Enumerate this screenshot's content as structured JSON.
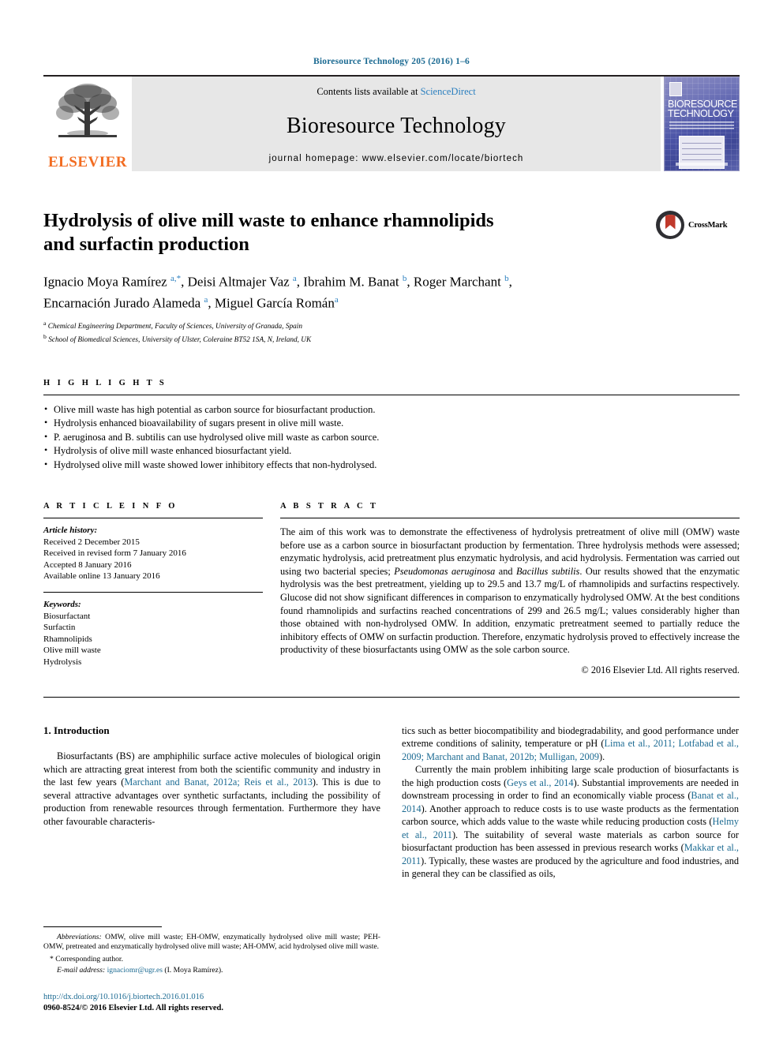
{
  "running_head": "Bioresource Technology 205 (2016) 1–6",
  "masthead": {
    "publisher": "ELSEVIER",
    "contents_prefix": "Contents lists available at ",
    "contents_link": "ScienceDirect",
    "journal_name": "Bioresource Technology",
    "homepage": "journal homepage: www.elsevier.com/locate/biortech",
    "cover_title_line1": "BIORESOURCE",
    "cover_title_line2": "TECHNOLOGY"
  },
  "article": {
    "title_line1": "Hydrolysis of olive mill waste to enhance rhamnolipids",
    "title_line2": "and surfactin production",
    "authors_line1_part1": "Ignacio Moya Ramírez ",
    "authors_line1_sup1": "a,*",
    "authors_line1_part2": ", Deisi Altmajer Vaz ",
    "authors_line1_sup2": "a",
    "authors_line1_part3": ", Ibrahim M. Banat ",
    "authors_line1_sup3": "b",
    "authors_line1_part4": ", Roger Marchant ",
    "authors_line1_sup4": "b",
    "authors_line1_part5": ",",
    "authors_line2_part1": "Encarnación Jurado Alameda ",
    "authors_line2_sup1": "a",
    "authors_line2_part2": ", Miguel García Román",
    "authors_line2_sup2": "a",
    "affil_a_sup": "a",
    "affil_a": " Chemical Engineering Department, Faculty of Sciences, University of Granada, Spain",
    "affil_b_sup": "b",
    "affil_b": " School of Biomedical Sciences, University of Ulster, Coleraine BT52 1SA, N, Ireland, UK",
    "crossmark_label": "CrossMark"
  },
  "highlights": {
    "heading": "H I G H L I G H T S",
    "items": [
      "Olive mill waste has high potential as carbon source for biosurfactant production.",
      "Hydrolysis enhanced bioavailability of sugars present in olive mill waste.",
      "P. aeruginosa and B. subtilis can use hydrolysed olive mill waste as carbon source.",
      "Hydrolysis of olive mill waste enhanced biosurfactant yield.",
      "Hydrolysed olive mill waste showed lower inhibitory effects that non-hydrolysed."
    ]
  },
  "article_info": {
    "heading": "A R T I C L E    I N F O",
    "history_label": "Article history:",
    "history": [
      "Received 2 December 2015",
      "Received in revised form 7 January 2016",
      "Accepted 8 January 2016",
      "Available online 13 January 2016"
    ],
    "keywords_label": "Keywords:",
    "keywords": [
      "Biosurfactant",
      "Surfactin",
      "Rhamnolipids",
      "Olive mill waste",
      "Hydrolysis"
    ]
  },
  "abstract": {
    "heading": "A B S T R A C T",
    "text_part1": "The aim of this work was to demonstrate the effectiveness of hydrolysis pretreatment of olive mill (OMW) waste before use as a carbon source in biosurfactant production by fermentation. Three hydrolysis methods were assessed; enzymatic hydrolysis, acid pretreatment plus enzymatic hydrolysis, and acid hydrolysis. Fermentation was carried out using two bacterial species; ",
    "species1": "Pseudomonas aeruginosa",
    "text_part2": " and ",
    "species2": "Bacillus subtilis",
    "text_part3": ". Our results showed that the enzymatic hydrolysis was the best pretreatment, yielding up to 29.5 and 13.7 mg/L of rhamnolipids and surfactins respectively. Glucose did not show significant differences in comparison to enzymatically hydrolysed OMW. At the best conditions found rhamnolipids and surfactins reached concentrations of 299 and 26.5 mg/L; values considerably higher than those obtained with non-hydrolysed OMW. In addition, enzymatic pretreatment seemed to partially reduce the inhibitory effects of OMW on surfactin production. Therefore, enzymatic hydrolysis proved to effectively increase the productivity of these biosurfactants using OMW as the sole carbon source.",
    "copyright": "© 2016 Elsevier Ltd. All rights reserved."
  },
  "introduction": {
    "heading": "1. Introduction",
    "left_p1_a": "Biosurfactants (BS) are amphiphilic surface active molecules of biological origin which are attracting great interest from both the scientific community and industry in the last few years (",
    "left_p1_cit1": "Marchant and Banat, 2012a; Reis et al., 2013",
    "left_p1_b": "). This is due to several attractive advantages over synthetic surfactants, including the possibility of production from renewable resources through fermentation. Furthermore they have other favourable characteris-",
    "right_p1_a": "tics such as better biocompatibility and biodegradability, and good performance under extreme conditions of salinity, temperature or pH (",
    "right_p1_cit1": "Lima et al., 2011; Lotfabad et al., 2009; Marchant and Banat, 2012b; Mulligan, 2009",
    "right_p1_b": ").",
    "right_p2_a": "Currently the main problem inhibiting large scale production of biosurfactants is the high production costs (",
    "right_p2_cit1": "Geys et al., 2014",
    "right_p2_b": "). Substantial improvements are needed in downstream processing in order to find an economically viable process (",
    "right_p2_cit2": "Banat et al., 2014",
    "right_p2_c": "). Another approach to reduce costs is to use waste products as the fermentation carbon source, which adds value to the waste while reducing production costs (",
    "right_p2_cit3": "Helmy et al., 2011",
    "right_p2_d": "). The suitability of several waste materials as carbon source for biosurfactant production has been assessed in previous research works (",
    "right_p2_cit4": "Makkar et al., 2011",
    "right_p2_e": "). Typically, these wastes are produced by the agriculture and food industries, and in general they can be classified as oils,"
  },
  "footnotes": {
    "abbrev_label": "Abbreviations:",
    "abbrev_text": " OMW, olive mill waste; EH-OMW, enzymatically hydrolysed olive mill waste; PEH-OMW, pretreated and enzymatically hydrolysed olive mill waste; AH-OMW, acid hydrolysed olive mill waste.",
    "corresponding": "* Corresponding author.",
    "email_label": "E-mail address:",
    "email": "ignaciomr@ugr.es",
    "email_suffix": " (I. Moya Ramírez).",
    "doi": "http://dx.doi.org/10.1016/j.biortech.2016.01.016",
    "issn": "0960-8524/© 2016 Elsevier Ltd. All rights reserved."
  },
  "colors": {
    "link": "#1b6a92",
    "sciencedirect": "#2b7fbf",
    "elsevier_orange": "#f26c21"
  }
}
